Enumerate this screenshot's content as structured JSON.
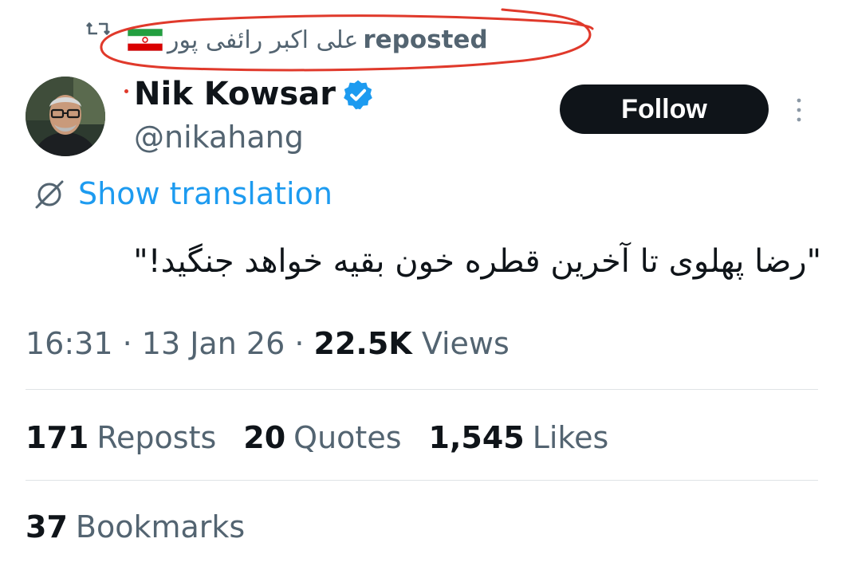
{
  "repost": {
    "reposter_name": "علی اکبر رائفی پور",
    "flag_icon": "iran-flag-icon",
    "label": "reposted",
    "annotation_color": "#e0392b"
  },
  "author": {
    "display_name": "Nik Kowsar",
    "handle": "@nikahang",
    "verified": true,
    "verified_color": "#1d9bf0"
  },
  "follow_button": {
    "label": "Follow"
  },
  "translation": {
    "label": "Show translation"
  },
  "tweet": {
    "text": "\"رضا پهلوی تا آخرین قطره خون بقیه خواهد جنگید!\""
  },
  "meta": {
    "time": "16:31",
    "separator_1": "·",
    "date": "13 Jan 26",
    "separator_2": "·",
    "views_count": "22.5K",
    "views_label": "Views"
  },
  "stats": {
    "reposts": {
      "count": "171",
      "label": "Reposts"
    },
    "quotes": {
      "count": "20",
      "label": "Quotes"
    },
    "likes": {
      "count": "1,545",
      "label": "Likes"
    },
    "bookmarks": {
      "count": "37",
      "label": "Bookmarks"
    }
  }
}
